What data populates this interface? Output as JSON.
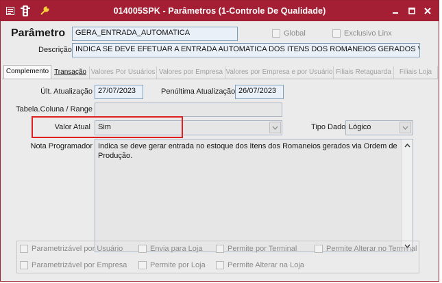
{
  "window": {
    "title": "014005SPK - Parâmetros (1-Controle De Qualidade)"
  },
  "header": {
    "parametro_label": "Parâmetro",
    "parametro_value": "GERA_ENTRADA_AUTOMATICA",
    "global_label": "Global",
    "global_checked": false,
    "exclusivo_label": "Exclusivo Linx",
    "exclusivo_checked": false,
    "descricao_label": "Descrição",
    "descricao_value": "INDICA SE DEVE EFETUAR A ENTRADA AUTOMATICA DOS ITENS DOS ROMANEIOS GERADOS VIA PROD"
  },
  "tabs": [
    {
      "label": "Complemento",
      "active": true
    },
    {
      "label": "Transação",
      "active": false
    },
    {
      "label": "Valores Por Usuários",
      "active": false
    },
    {
      "label": "Valores por Empresa",
      "active": false
    },
    {
      "label": "Valores por Empresa e por Usuário",
      "active": false
    },
    {
      "label": "Filiais Retaguarda",
      "active": false
    },
    {
      "label": "Filiais Loja",
      "active": false
    }
  ],
  "complemento": {
    "ult_atualizacao_label": "Últ. Atualização",
    "ult_atualizacao_value": "27/07/2023",
    "penultima_label": "Penúltima Atualização",
    "penultima_value": "26/07/2023",
    "tabela_label": "Tabela.Coluna / Range",
    "tabela_value": "",
    "valor_atual_label": "Valor Atual",
    "valor_atual_value": "Sim",
    "tipo_dado_label": "Tipo Dado",
    "tipo_dado_value": "Lógico",
    "nota_label": "Nota Programador",
    "nota_value": "Indica se deve gerar entrada no estoque dos Itens dos Romaneios gerados via Ordem de Produção."
  },
  "options": {
    "row1": [
      {
        "label": "Parametrizável por Usuário",
        "checked": false
      },
      {
        "label": "Envia para Loja",
        "checked": false
      },
      {
        "label": "Permite por Terminal",
        "checked": false
      },
      {
        "label": "Permite Alterar no Terminal",
        "checked": false
      }
    ],
    "row2": [
      {
        "label": "Parametrizável por Empresa",
        "checked": false
      },
      {
        "label": "Permite por Loja",
        "checked": false
      },
      {
        "label": "Permite Alterar na Loja",
        "checked": false
      }
    ]
  },
  "colors": {
    "titlebar": "#a41e34",
    "highlight": "#e02020"
  },
  "icons": {
    "titlebar_left": [
      "window-menu-icon",
      "traffic-light-icon",
      "wrench-icon"
    ],
    "window_controls": [
      "minimize-icon",
      "maximize-icon",
      "close-icon"
    ]
  }
}
